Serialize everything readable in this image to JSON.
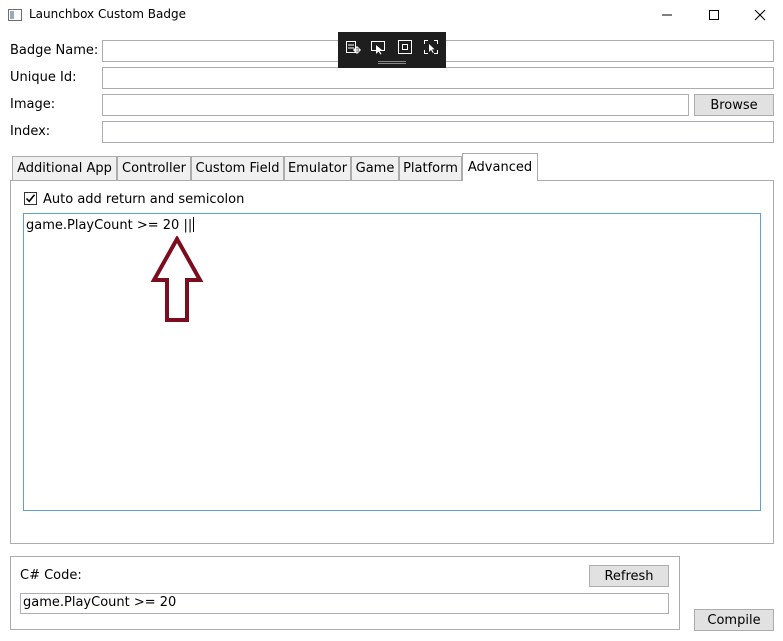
{
  "window": {
    "title": "Launchbox Custom Badge",
    "controls": [
      "minimize-icon",
      "maximize-icon",
      "close-icon"
    ]
  },
  "debug_toolbar": {
    "icons": [
      "visual-tree-icon",
      "select-element-icon",
      "display-layout-adorners-icon",
      "track-focused-element-icon"
    ]
  },
  "form": {
    "badge_name_label": "Badge Name:",
    "badge_name_value": "",
    "unique_id_label": "Unique Id:",
    "unique_id_value": "",
    "image_label": "Image:",
    "image_value": "",
    "browse_label": "Browse",
    "index_label": "Index:",
    "index_value": ""
  },
  "tabs": [
    {
      "label": "Additional App"
    },
    {
      "label": "Controller"
    },
    {
      "label": "Custom Field"
    },
    {
      "label": "Emulator"
    },
    {
      "label": "Game"
    },
    {
      "label": "Platform"
    },
    {
      "label": "Advanced",
      "active": true
    }
  ],
  "advanced": {
    "auto_add_label": "Auto add return and semicolon",
    "auto_add_checked": true,
    "code": "game.PlayCount >= 20 ||"
  },
  "csharp": {
    "label": "C# Code:",
    "refresh_label": "Refresh",
    "code": "game.PlayCount >= 20"
  },
  "compile_label": "Compile",
  "colors": {
    "annotation_arrow": "#7b0d1e",
    "focus_border": "#5f9fd1",
    "debug_toolbar_bg": "#1e1e1e"
  }
}
